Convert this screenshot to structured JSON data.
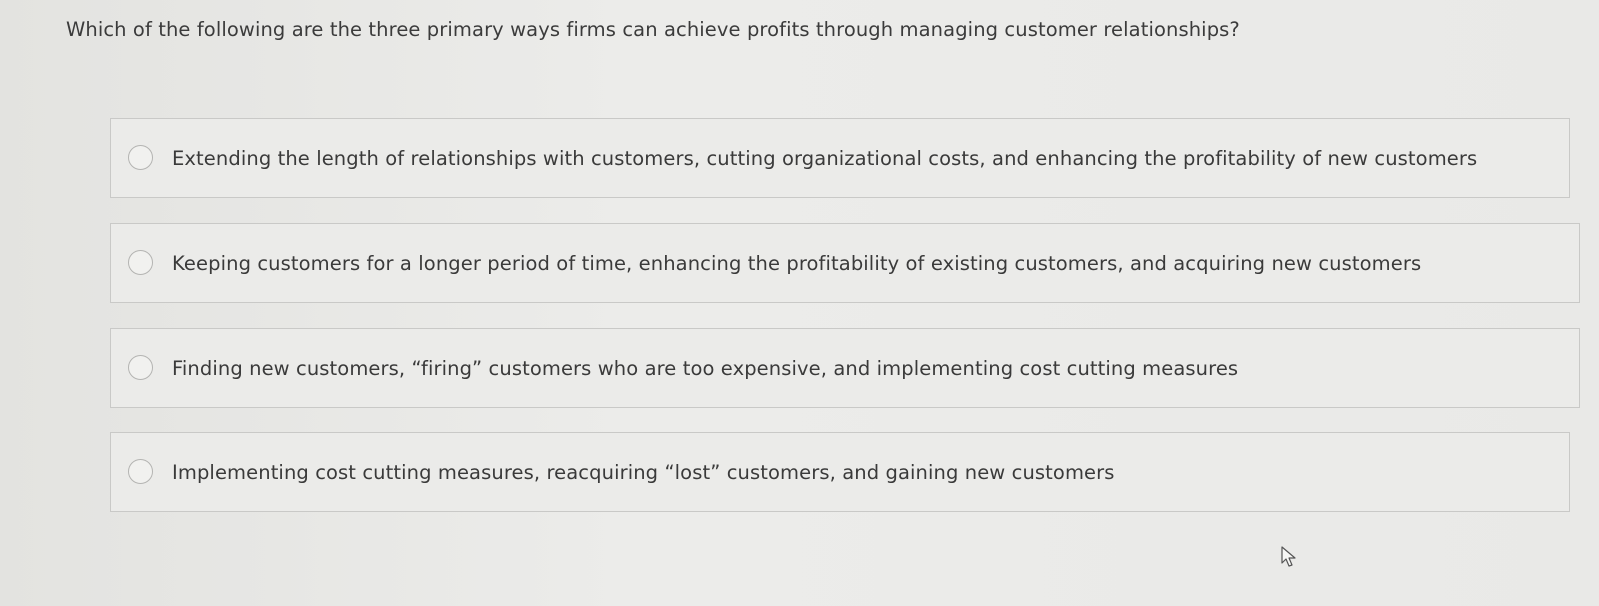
{
  "question": {
    "text": "Which of the following are the three primary ways firms can achieve profits through managing customer relationships?"
  },
  "options": [
    {
      "label": "Extending the length of relationships with customers, cutting organizational costs, and enhancing the profitability of new customers"
    },
    {
      "label": "Keeping customers for a longer period of time, enhancing the profitability of existing customers, and acquiring new customers"
    },
    {
      "label": "Finding new customers, “firing” customers who are too expensive, and implementing cost cutting measures"
    },
    {
      "label": "Implementing cost cutting measures, reacquiring “lost” customers, and gaining new customers"
    }
  ],
  "icons": {
    "cursor": "mouse-pointer-icon",
    "radio": "radio-empty-icon"
  },
  "colors": {
    "background": "#e8e8e6",
    "option_border": "#c9c9c7",
    "text": "#3a3a3a"
  }
}
